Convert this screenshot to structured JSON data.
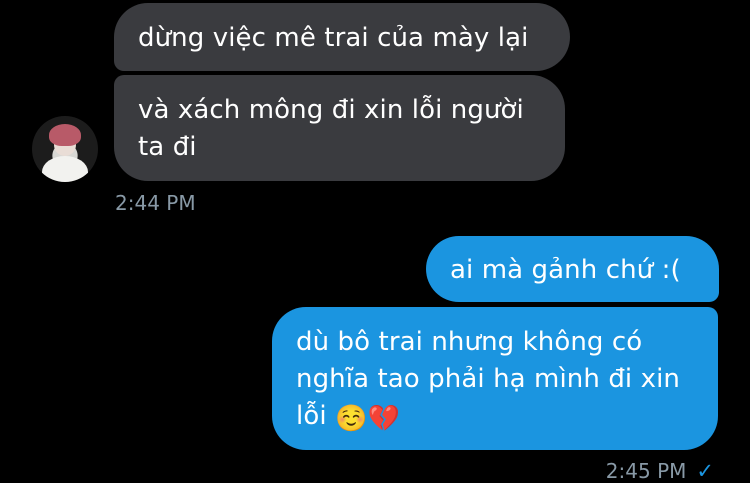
{
  "conversation": {
    "incoming": {
      "messages": [
        "dừng việc mê trai của mày lại",
        "và xách mông đi xin lỗi người ta đi"
      ],
      "timestamp": "2:44 PM",
      "avatar_icon": "user-avatar"
    },
    "outgoing": {
      "messages": [
        "ai mà gảnh chứ :(",
        "dù bô trai nhưng không có nghĩa tao phải hạ mình đi xin lỗi"
      ],
      "emoji_1": "☺️",
      "emoji_2": "💔",
      "timestamp": "2:45 PM",
      "read_receipt_icon": "checkmark-icon",
      "read_receipt_glyph": "✓"
    }
  },
  "colors": {
    "background": "#000000",
    "incoming_bubble": "#3a3b3f",
    "outgoing_bubble": "#1b95e0",
    "timestamp": "#8899a6"
  }
}
